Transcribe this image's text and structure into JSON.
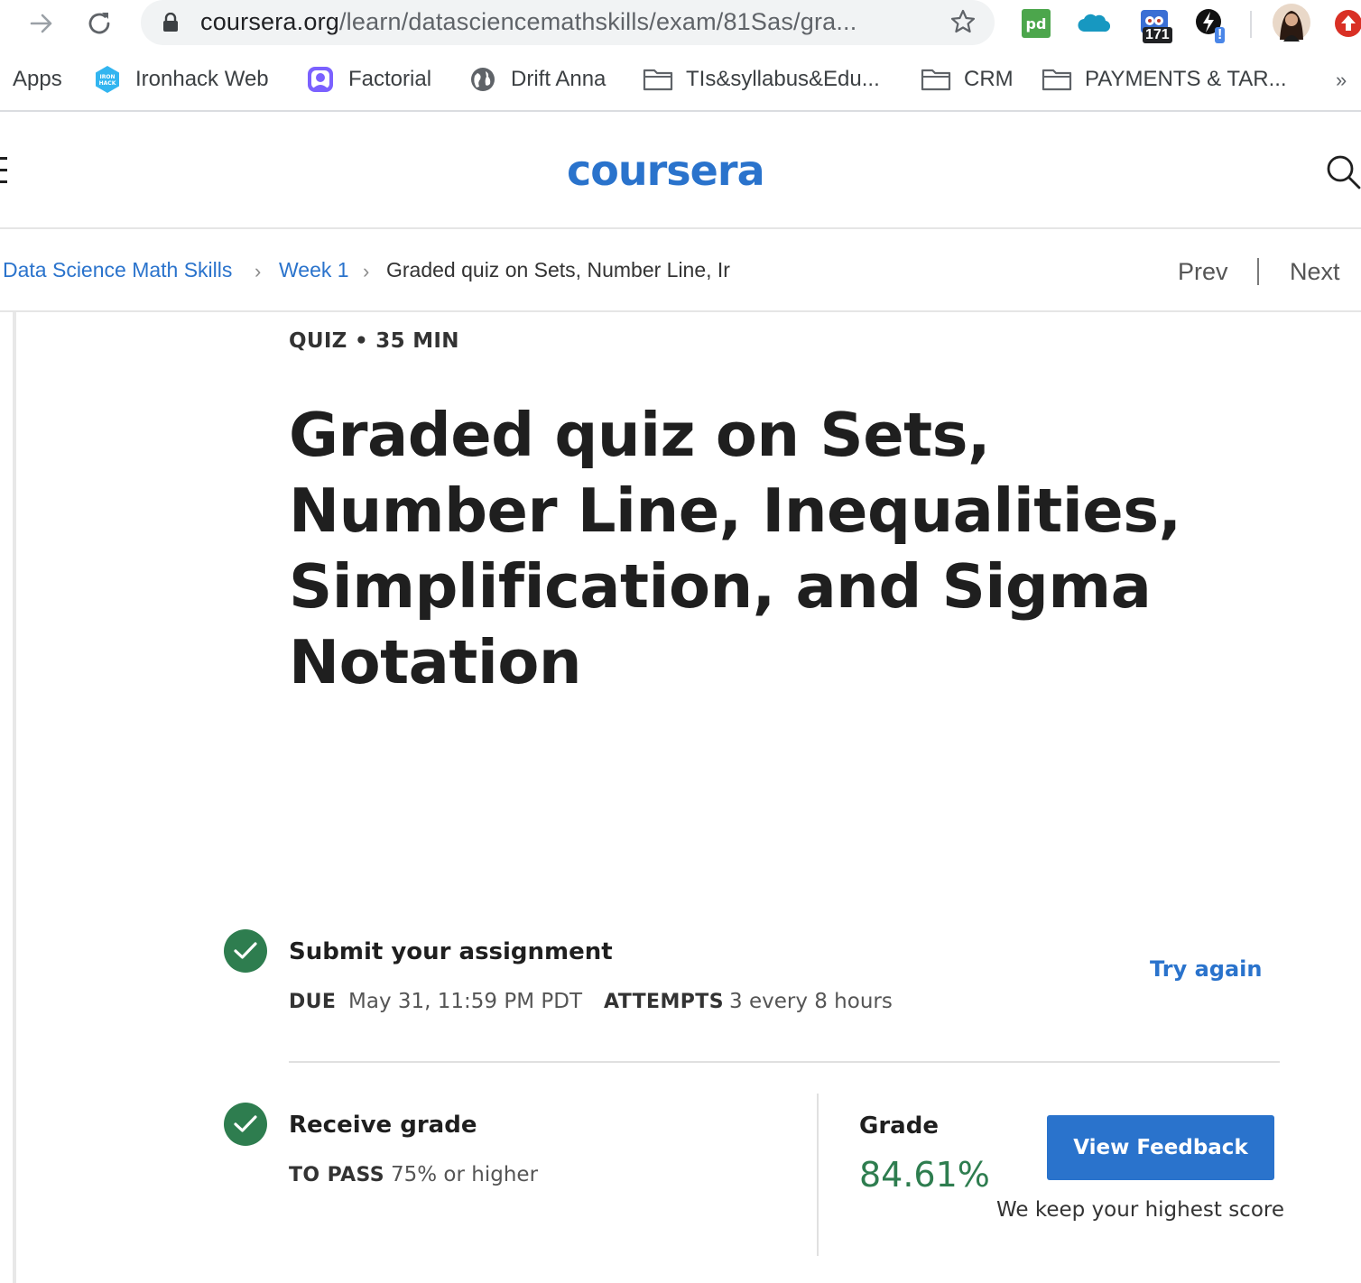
{
  "browser": {
    "url_host": "coursera.org",
    "url_path": "/learn/datasciencemathskills/exam/81Sas/gra...",
    "extension_badge_count": "171",
    "extension_alert_badge": "!"
  },
  "bookmarks": [
    {
      "label": "Apps",
      "icon": "apps-grid-icon"
    },
    {
      "label": "Ironhack Web",
      "icon": "ironhack-icon"
    },
    {
      "label": "Factorial",
      "icon": "factorial-icon"
    },
    {
      "label": "Drift Anna",
      "icon": "globe-icon"
    },
    {
      "label": "TIs&syllabus&Edu...",
      "icon": "folder-icon"
    },
    {
      "label": "CRM",
      "icon": "folder-icon"
    },
    {
      "label": "PAYMENTS & TAR...",
      "icon": "folder-icon"
    }
  ],
  "bookmarks_overflow": "»",
  "site": {
    "logo": "coursera",
    "brand_color": "#2a73cc"
  },
  "breadcrumb": {
    "course": "Data Science Math Skills",
    "week": "Week 1",
    "current": "Graded quiz on Sets, Number Line, Ir",
    "separator": "›",
    "prev": "Prev",
    "next": "Next"
  },
  "quiz": {
    "meta": "QUIZ • 35 MIN",
    "title": "Graded quiz on Sets, Number Line, Inequalities, Simplification, and Sigma Notation"
  },
  "submit": {
    "title": "Submit your assignment",
    "due_label": "DUE",
    "due_value": "May 31, 11:59 PM PDT",
    "attempts_label": "ATTEMPTS",
    "attempts_value": "3 every 8 hours",
    "try_again": "Try again"
  },
  "receive": {
    "title": "Receive grade",
    "to_pass_label": "TO PASS",
    "to_pass_value": "75% or higher",
    "grade_label": "Grade",
    "grade_value": "84.61%",
    "view_feedback": "View Feedback",
    "note": "We keep your highest score"
  },
  "colors": {
    "success": "#2e7d4f",
    "link": "#2a73cc"
  }
}
